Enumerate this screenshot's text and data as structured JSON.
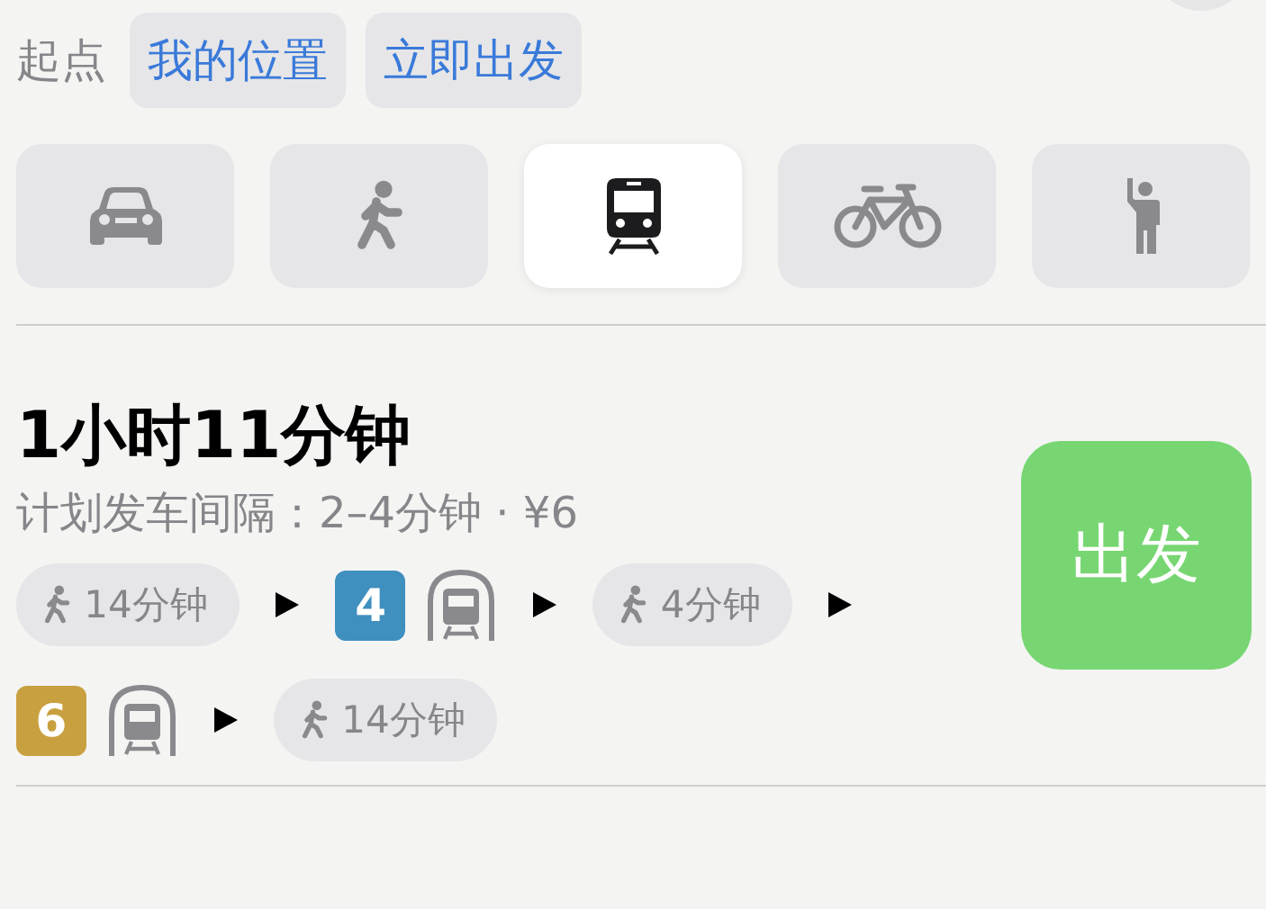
{
  "origin": {
    "label": "起点",
    "chips": [
      "我的位置",
      "立即出发"
    ]
  },
  "modes": [
    {
      "kind": "car",
      "selected": false
    },
    {
      "kind": "walk",
      "selected": false
    },
    {
      "kind": "transit",
      "selected": true
    },
    {
      "kind": "bike",
      "selected": false
    },
    {
      "kind": "hail",
      "selected": false
    }
  ],
  "route": {
    "duration": "1小时11分钟",
    "details": "计划发车间隔：2–4分钟 · ¥6",
    "go_button": "出发",
    "steps": [
      {
        "kind": "walk",
        "text": "14分钟"
      },
      {
        "kind": "line",
        "text": "4",
        "color": "#3f8fbf"
      },
      {
        "kind": "walk",
        "text": "4分钟"
      },
      {
        "kind": "line",
        "text": "6",
        "color": "#c9a040"
      },
      {
        "kind": "walk",
        "text": "14分钟"
      }
    ]
  }
}
